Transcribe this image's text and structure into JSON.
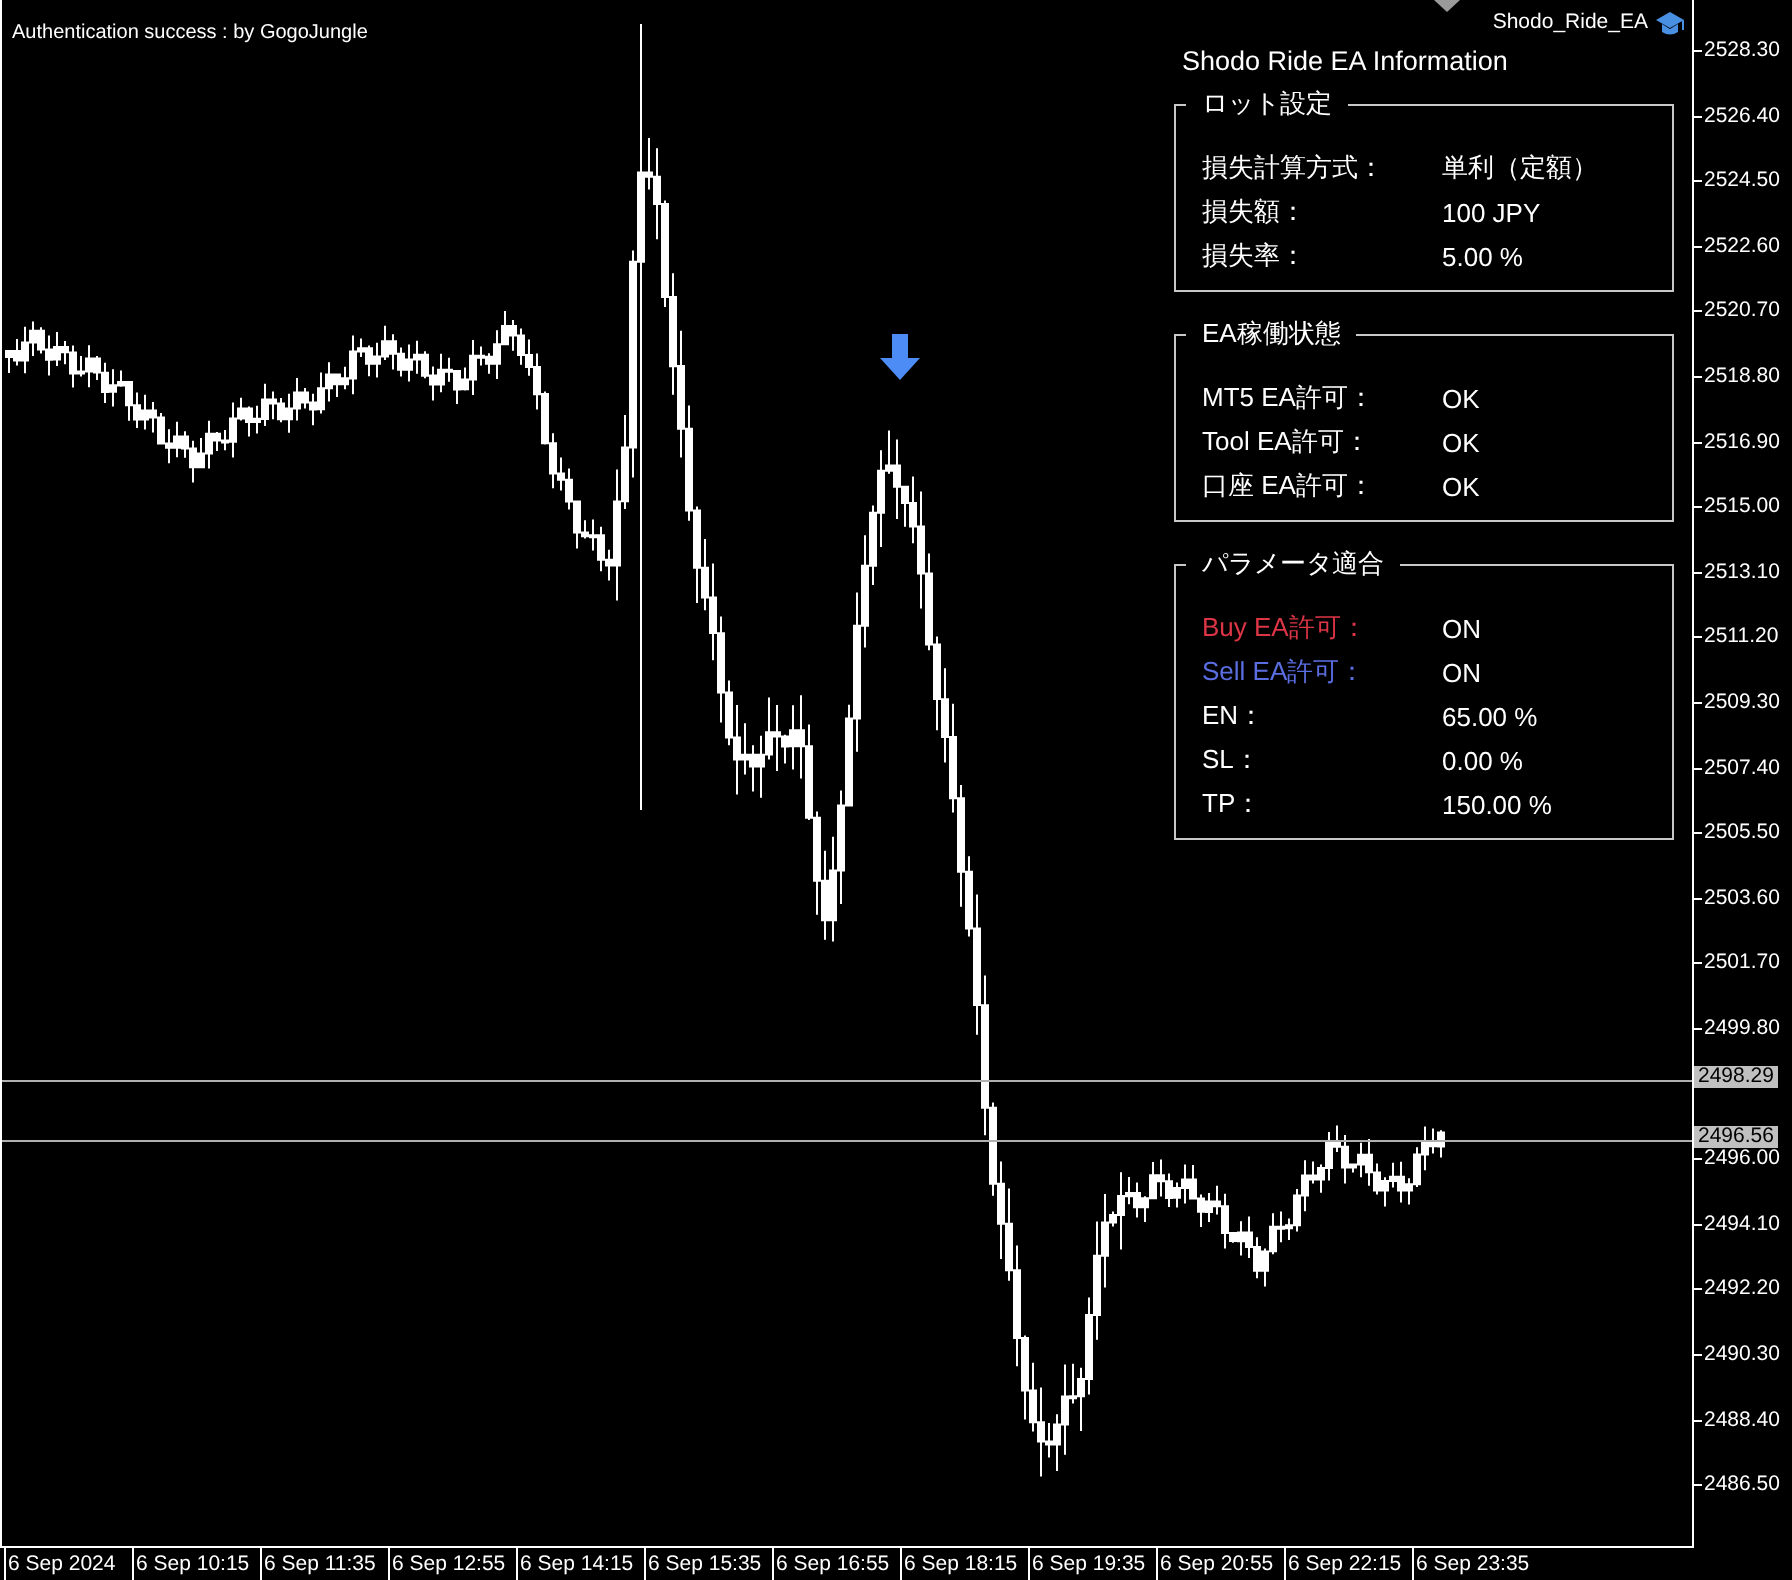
{
  "chart": {
    "notice": "Authentication success : by GogoJungle",
    "ea_name": "Shodo_Ride_EA",
    "price_axis": [
      "2528.30",
      "2526.40",
      "2524.50",
      "2522.60",
      "2520.70",
      "2518.80",
      "2516.90",
      "2515.00",
      "2513.10",
      "2511.20",
      "2509.30",
      "2507.40",
      "2505.50",
      "2503.60",
      "2501.70",
      "2499.80",
      "2496.00",
      "2494.10",
      "2492.20",
      "2490.30",
      "2488.40",
      "2486.50"
    ],
    "price_lines": [
      {
        "label": "2498.29"
      },
      {
        "label": "2496.56"
      }
    ],
    "time_axis": [
      "6 Sep 2024",
      "6 Sep 10:15",
      "6 Sep 11:35",
      "6 Sep 12:55",
      "6 Sep 14:15",
      "6 Sep 15:35",
      "6 Sep 16:55",
      "6 Sep 18:15",
      "6 Sep 19:35",
      "6 Sep 20:55",
      "6 Sep 22:15",
      "6 Sep 23:35"
    ]
  },
  "panel": {
    "title": "Shodo Ride EA Information",
    "groups": [
      {
        "title": "ロット設定",
        "rows": [
          {
            "label": "損失計算方式：",
            "value": "単利（定額）",
            "color": "#ffffff"
          },
          {
            "label": "損失額：",
            "value": "100 JPY",
            "color": "#ffffff"
          },
          {
            "label": "損失率：",
            "value": "5.00 %",
            "color": "#ffffff"
          }
        ]
      },
      {
        "title": "EA稼働状態",
        "rows": [
          {
            "label": "MT5 EA許可：",
            "value": "OK",
            "color": "#ffffff"
          },
          {
            "label": "Tool EA許可：",
            "value": "OK",
            "color": "#ffffff"
          },
          {
            "label": "口座 EA許可：",
            "value": "OK",
            "color": "#ffffff"
          }
        ]
      },
      {
        "title": "パラメータ適合",
        "rows": [
          {
            "label": "Buy EA許可：",
            "value": "ON",
            "color": "#dc3545"
          },
          {
            "label": "Sell EA許可：",
            "value": "ON",
            "color": "#5b6ee1"
          },
          {
            "label": "EN：",
            "value": "65.00 %",
            "color": "#ffffff"
          },
          {
            "label": "SL：",
            "value": "0.00 %",
            "color": "#ffffff"
          },
          {
            "label": "TP：",
            "value": "150.00 %",
            "color": "#ffffff"
          }
        ]
      }
    ]
  }
}
